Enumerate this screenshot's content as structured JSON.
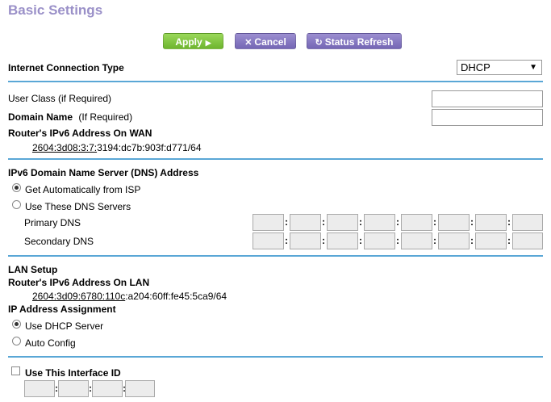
{
  "page_title": "Basic Settings",
  "toolbar": {
    "apply_label": "Apply",
    "cancel_label": "Cancel",
    "refresh_label": "Status Refresh",
    "apply_icon": "play-arrow-icon",
    "cancel_icon": "close-icon",
    "refresh_icon": "refresh-icon"
  },
  "connection": {
    "label": "Internet Connection Type",
    "selected": "DHCP"
  },
  "user_class": {
    "label": "User Class (if Required)",
    "value": ""
  },
  "domain_name": {
    "label": "Domain Name",
    "hint": "(If Required)",
    "value": ""
  },
  "wan": {
    "label": "Router's IPv6 Address On WAN",
    "prefix": "2604:3d08:3:7:",
    "suffix": "3194:dc7b:903f:d771/64"
  },
  "dns": {
    "heading": "IPv6 Domain Name Server (DNS) Address",
    "option_auto": "Get Automatically from ISP",
    "option_manual": "Use These DNS Servers",
    "primary_label": "Primary DNS",
    "secondary_label": "Secondary DNS",
    "selected": "auto"
  },
  "lan": {
    "heading": "LAN Setup",
    "address_label": "Router's IPv6 Address On LAN",
    "prefix": "2604:3d09:6780:110c",
    "suffix": ":a204:60ff:fe45:5ca9/64"
  },
  "assignment": {
    "heading": "IP Address Assignment",
    "option_dhcp": "Use DHCP Server",
    "option_auto": "Auto Config",
    "selected": "dhcp"
  },
  "interface_id": {
    "label": "Use This Interface ID",
    "checked": false
  },
  "colors": {
    "accent_line": "#5aa7d6",
    "title": "#9a90c8",
    "apply": "#7fc241",
    "purple": "#8677c4"
  }
}
